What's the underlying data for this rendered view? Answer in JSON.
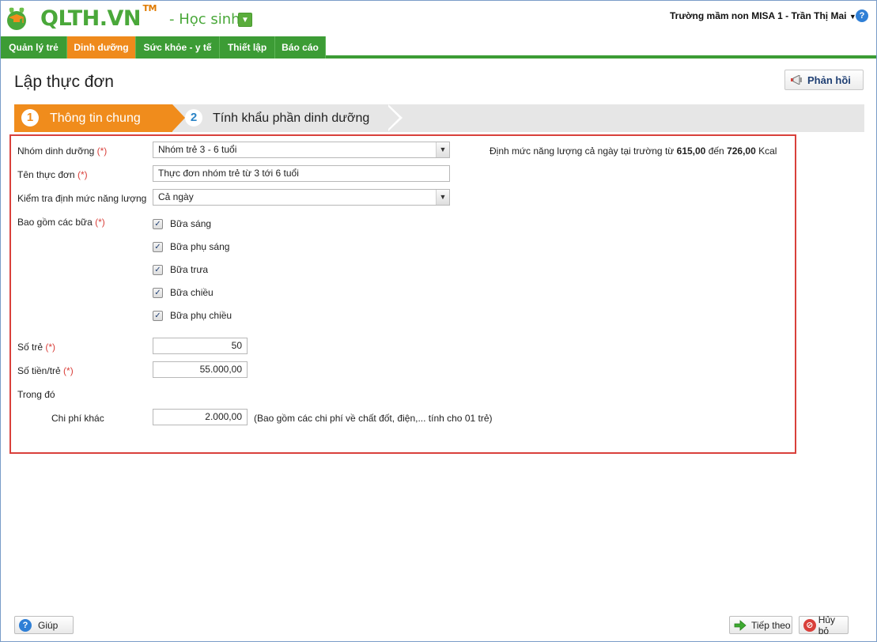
{
  "header": {
    "logo_text": "QLTH.VN",
    "logo_tm": "TM",
    "role": "- Học sinh",
    "user": "Trường mầm non MISA 1 - Trần Thị Mai"
  },
  "nav": {
    "tabs": [
      {
        "label": "Quản lý trẻ",
        "active": false
      },
      {
        "label": "Dinh dưỡng",
        "active": true
      },
      {
        "label": "Sức khỏe - y tế",
        "active": false
      },
      {
        "label": "Thiết lập",
        "active": false
      },
      {
        "label": "Báo cáo",
        "active": false
      }
    ]
  },
  "page": {
    "title": "Lập thực đơn",
    "feedback_label": "Phản hồi"
  },
  "steps": [
    {
      "number": "1",
      "label": "Thông tin chung",
      "active": true
    },
    {
      "number": "2",
      "label": "Tính khẩu phần dinh dưỡng",
      "active": false
    }
  ],
  "form": {
    "nutrition_group_label": "Nhóm dinh dưỡng",
    "nutrition_group_value": "Nhóm trẻ 3 - 6 tuổi",
    "energy_note_prefix": "Định mức năng lượng cả ngày tại trường từ",
    "energy_min": "615,00",
    "energy_mid": "đến",
    "energy_max": "726,00",
    "energy_unit": "Kcal",
    "menu_name_label": "Tên thực đơn",
    "menu_name_value": "Thực đơn nhóm trẻ từ 3 tới 6 tuổi",
    "energy_check_label": "Kiểm tra định mức năng lượng",
    "energy_check_value": "Cả ngày",
    "meals_label": "Bao gồm các bữa",
    "meals": [
      {
        "label": "Bữa sáng",
        "checked": true
      },
      {
        "label": "Bữa phụ sáng",
        "checked": true
      },
      {
        "label": "Bữa trưa",
        "checked": true
      },
      {
        "label": "Bữa chiều",
        "checked": true
      },
      {
        "label": "Bữa phụ chiều",
        "checked": true
      }
    ],
    "children_label": "Số trẻ",
    "children_value": "50",
    "money_label": "Số tiền/trẻ",
    "money_value": "55.000,00",
    "of_which_label": "Trong đó",
    "other_cost_label": "Chi phí khác",
    "other_cost_value": "2.000,00",
    "other_cost_note": "(Bao gồm các chi phí về chất đốt, điện,... tính cho 01 trẻ)",
    "required_mark": "(*)"
  },
  "footer": {
    "help_label": "Giúp",
    "next_label": "Tiếp theo",
    "cancel_label": "Hủy bỏ"
  },
  "colors": {
    "brand_green": "#3c9c35",
    "active_orange": "#ef8a1c",
    "highlight_red": "#d9403b"
  }
}
